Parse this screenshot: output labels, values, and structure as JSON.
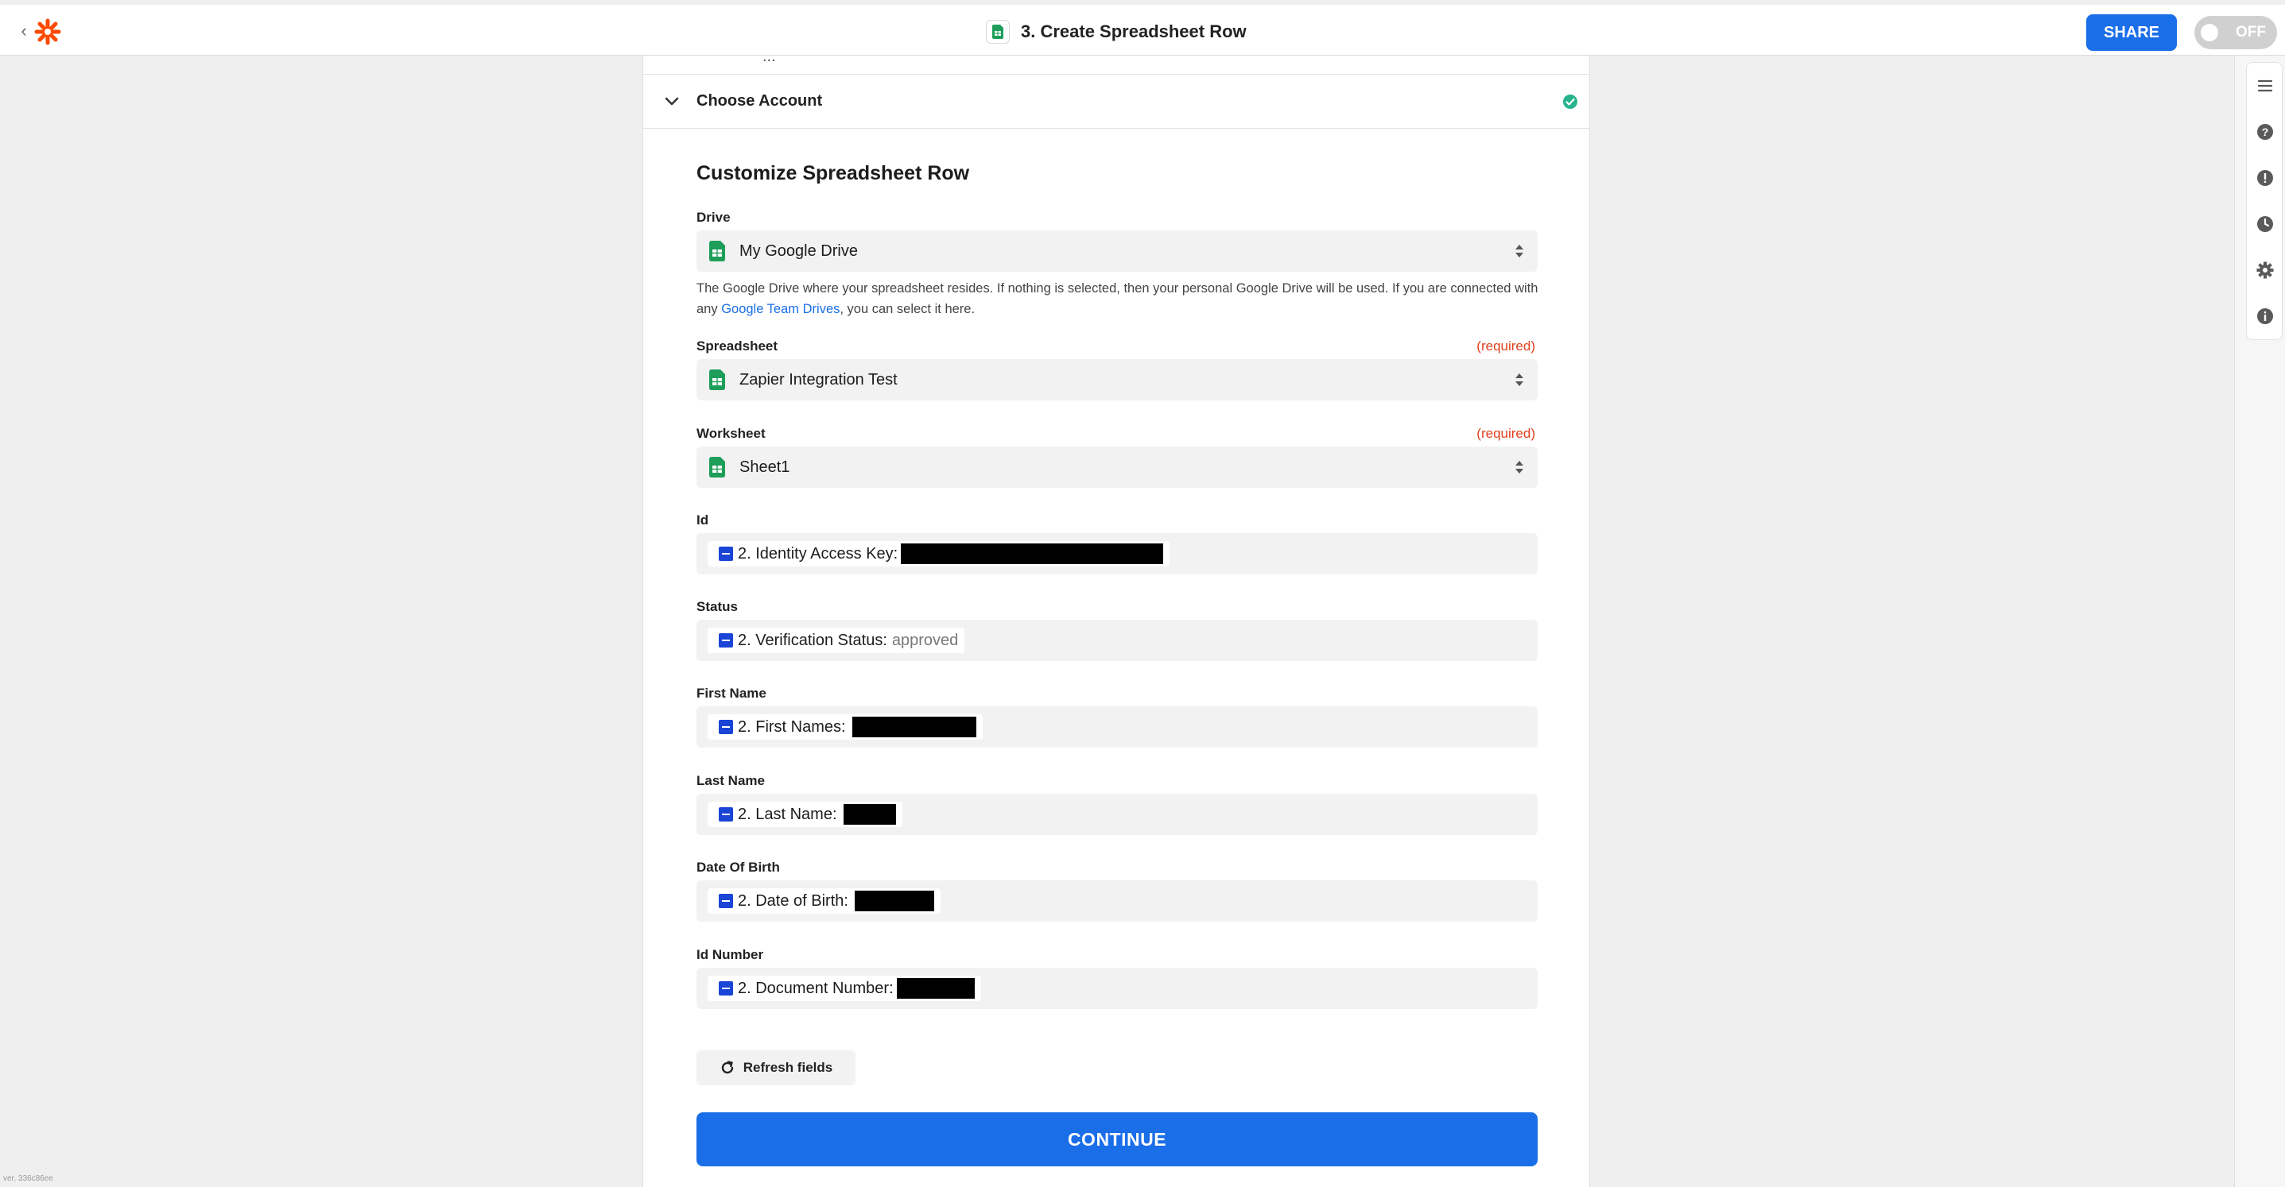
{
  "header": {
    "title": "3. Create Spreadsheet Row",
    "share_label": "SHARE",
    "toggle_label": "OFF"
  },
  "panel": {
    "previous_section_partial": "...",
    "choose_account_label": "Choose Account",
    "section_title": "Customize Spreadsheet Row",
    "drive": {
      "label": "Drive",
      "value": "My Google Drive",
      "help_before": "The Google Drive where your spreadsheet resides. If nothing is selected, then your personal Google Drive will be used. If you are connected with any ",
      "help_link": "Google Team Drives",
      "help_after": ", you can select it here."
    },
    "spreadsheet": {
      "label": "Spreadsheet",
      "required": "(required)",
      "value": "Zapier Integration Test"
    },
    "worksheet": {
      "label": "Worksheet",
      "required": "(required)",
      "value": "Sheet1"
    },
    "fields": [
      {
        "label": "Id",
        "pill": "2. Identity Access Key:",
        "value": ""
      },
      {
        "label": "Status",
        "pill": "2. Verification Status:",
        "value": "approved"
      },
      {
        "label": "First Name",
        "pill": "2. First Names:",
        "value": ""
      },
      {
        "label": "Last Name",
        "pill": "2. Last Name:",
        "value": ""
      },
      {
        "label": "Date Of Birth",
        "pill": "2. Date of Birth:",
        "value": ""
      },
      {
        "label": "Id Number",
        "pill": "2. Document Number:",
        "value": ""
      }
    ],
    "refresh_label": "Refresh fields",
    "continue_label": "CONTINUE"
  },
  "icons": {
    "back": "chevron-left-icon",
    "logo": "zapier-logo",
    "app": "google-sheets-icon",
    "rail": [
      "outline-icon",
      "help-icon",
      "alert-icon",
      "history-icon",
      "settings-icon",
      "info-icon"
    ]
  },
  "colors": {
    "accent": "#1a6ee8",
    "brand": "#ff4a00",
    "required": "#e2401d",
    "success": "#26b38e",
    "sheets_green": "#1e9e5a"
  },
  "footer": {
    "version": "ver. 336c86ee"
  }
}
